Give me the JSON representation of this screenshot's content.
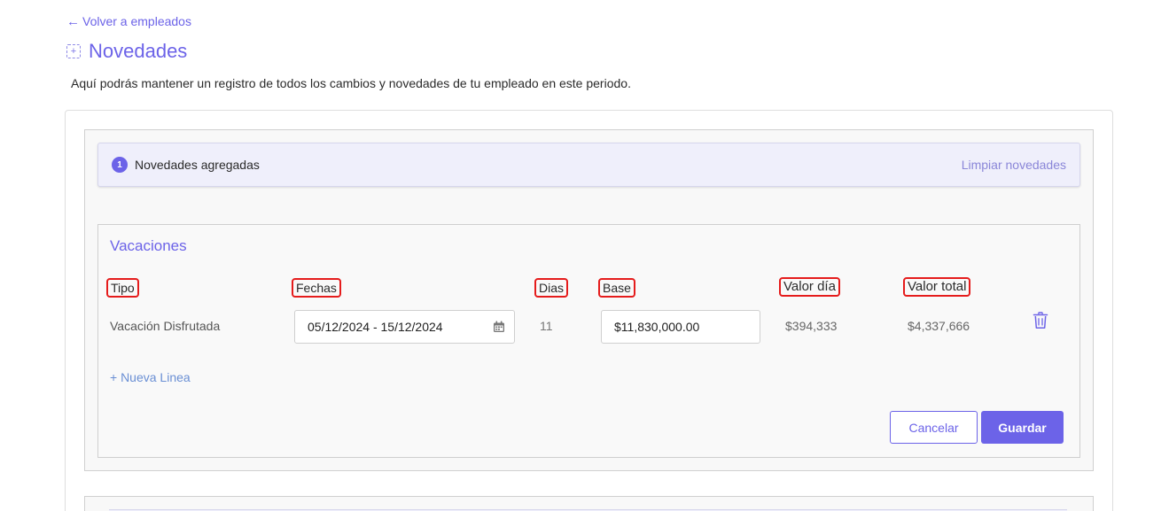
{
  "header": {
    "back_link": "Volver a empleados",
    "title": "Novedades",
    "subtitle": "Aquí podrás mantener un registro de todos los cambios y novedades de tu empleado en este periodo."
  },
  "summary": {
    "count": "1",
    "label": "Novedades agregadas",
    "clear_link": "Limpiar novedades"
  },
  "novelty": {
    "title": "Vacaciones",
    "columns": {
      "tipo": "Tipo",
      "fechas": "Fechas",
      "dias": "Dias",
      "base": "Base",
      "valor_dia": "Valor día",
      "valor_total": "Valor total"
    },
    "row": {
      "tipo": "Vacación Disfrutada",
      "fechas": "05/12/2024 - 15/12/2024",
      "dias": "11",
      "base": "$11,830,000.00",
      "valor_dia": "$394,333",
      "valor_total": "$4,337,666"
    },
    "new_line": "+ Nueva Linea",
    "cancel_button": "Cancelar",
    "save_button": "Guardar"
  },
  "colors": {
    "accent": "#6c63e8",
    "annotation": "#e51c1c"
  },
  "icons": {
    "back": "arrow-left-icon",
    "title": "add-novelty-icon",
    "date": "calendar-icon",
    "delete": "trash-icon"
  }
}
